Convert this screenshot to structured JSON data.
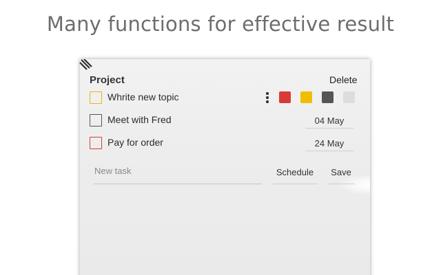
{
  "headline": "Many functions for effective result",
  "project": {
    "title": "Project",
    "delete_label": "Delete"
  },
  "tasks": [
    {
      "label": "Whrite new topic",
      "checkbox_color": "#f0b400",
      "date": ""
    },
    {
      "label": "Meet with Fred",
      "checkbox_color": "#555555",
      "date": "04 May"
    },
    {
      "label": "Pay for order",
      "checkbox_color": "#d83a3a",
      "date": "24 May"
    }
  ],
  "color_options": [
    {
      "name": "red",
      "hex": "#d83a3a"
    },
    {
      "name": "yellow",
      "hex": "#f0be00"
    },
    {
      "name": "dark-gray",
      "hex": "#555555"
    },
    {
      "name": "light-gray",
      "hex": "#dddddd"
    }
  ],
  "new_task": {
    "placeholder": "New task",
    "schedule_label": "Schedule",
    "save_label": "Save"
  },
  "icons": {
    "drag": "drag-handle-icon",
    "more": "kebab-menu-icon"
  }
}
